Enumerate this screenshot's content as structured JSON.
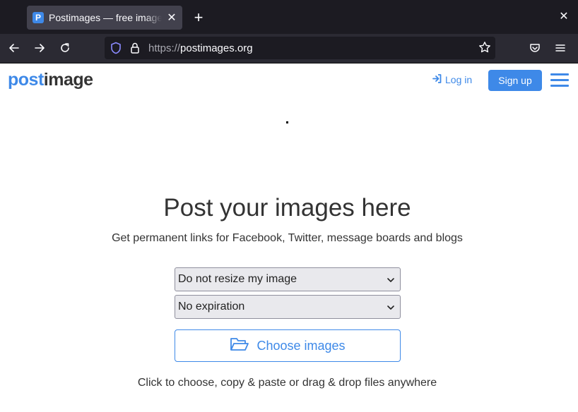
{
  "browser": {
    "tab_title": "Postimages — free image hosting",
    "tab_favicon_letter": "P",
    "url_scheme": "https://",
    "url_host": "postimages.org"
  },
  "site": {
    "logo_part1": "post",
    "logo_part2": "image",
    "login_label": "Log in",
    "signup_label": "Sign up"
  },
  "main": {
    "headline": "Post your images here",
    "subheadline": "Get permanent links for Facebook, Twitter, message boards and blogs",
    "resize_select_value": "Do not resize my image",
    "expiration_select_value": "No expiration",
    "choose_button_label": "Choose images",
    "hint": "Click to choose, copy & paste or drag & drop files anywhere"
  },
  "colors": {
    "accent": "#3e89e8",
    "tabbar": "#1c1b22",
    "navbar": "#2b2a33"
  },
  "icons": [
    "close-icon",
    "plus-icon",
    "back-icon",
    "forward-icon",
    "reload-icon",
    "shield-icon",
    "lock-icon",
    "star-icon",
    "pocket-icon",
    "menu-icon",
    "sign-in-icon",
    "hamburger-icon",
    "folder-open-icon",
    "chevron-down-icon"
  ]
}
